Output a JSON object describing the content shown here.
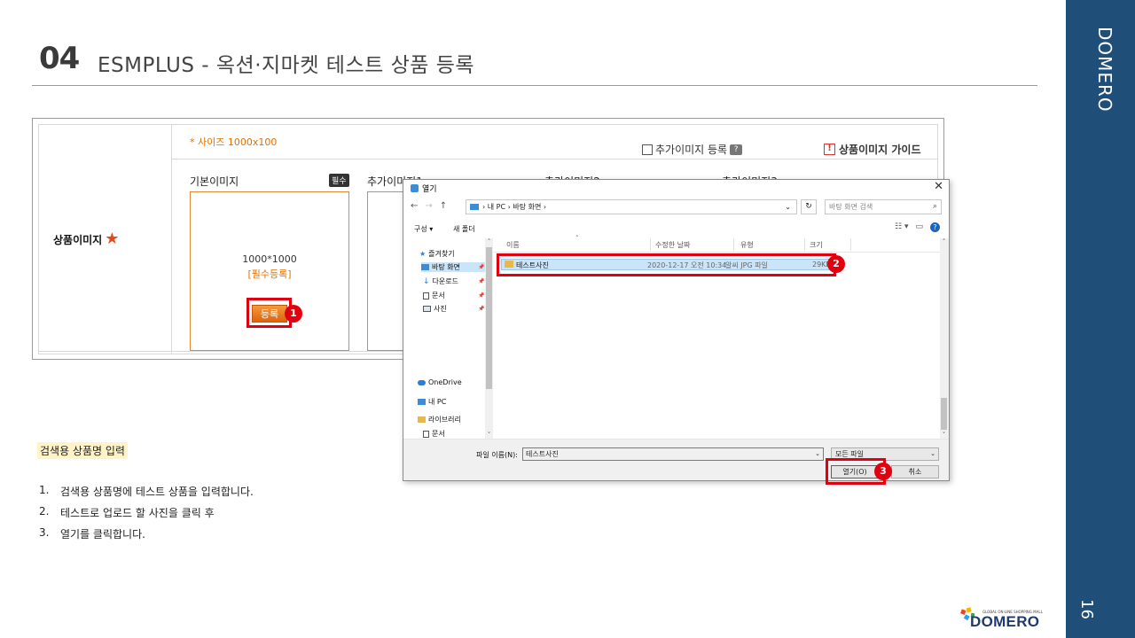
{
  "slide": {
    "number": "04",
    "title": "ESMPLUS - 옥션·지마켓 테스트 상품 등록",
    "brand": "DOMERO",
    "page": "16"
  },
  "esm_form": {
    "row_label": "상품이미지",
    "size_note": "* 사이즈 1000x100",
    "add_image_checkbox": "추가이미지 등록",
    "help_icon_text": "?",
    "guide_link": "상품이미지 가이드",
    "warn_icon_text": "!",
    "base_image_label": "기본이미지",
    "required_badge": "필수",
    "add_image_1": "추가이미지1",
    "add_image_2": "추가이미지2",
    "add_image_3": "추가이미지3",
    "dimensions": "1000*1000",
    "required_register": "[필수등록]",
    "register_button": "등록",
    "star_icon": "★"
  },
  "steps": {
    "s1": "1",
    "s2": "2",
    "s3": "3"
  },
  "description": {
    "section_tag": "검색용 상품명 입력",
    "items": [
      {
        "num": "1.",
        "text": "검색용 상품명에 테스트 상품을 입력합니다."
      },
      {
        "num": "2.",
        "text": "테스트로 업로드 할 사진을 클릭 후"
      },
      {
        "num": "3.",
        "text": "열기를 클릭합니다."
      }
    ]
  },
  "logo": {
    "tagline": "GLOBAL ON-LINE SHOPPING MALL",
    "word": "DOMERO"
  },
  "dialog": {
    "title": "열기",
    "close_glyph": "✕",
    "back_glyph": "←",
    "forward_glyph": "→",
    "up_glyph": "↑",
    "breadcrumb": "›  내 PC  ›  바탕 화면  ›",
    "dropdown_glyph": "⌄",
    "refresh_glyph": "↻",
    "search_placeholder": "바탕 화면 검색",
    "search_glyph": "⌕",
    "organize": "구성 ▾",
    "new_folder": "새 폴더",
    "view_glyph": "☷ ▾",
    "pane_glyph": "▭",
    "help_glyph": "?",
    "scroll_up": "˄",
    "scroll_down": "˅",
    "tree": {
      "favorites": "즐겨찾기",
      "desktop": "바탕 화면",
      "downloads": "다운로드",
      "documents": "문서",
      "pictures": "사진",
      "onedrive": "OneDrive",
      "this_pc": "내 PC",
      "libraries": "라이브러리",
      "lib_documents": "문서",
      "pin_glyph": "📌"
    },
    "columns": {
      "name": "이름",
      "modified": "수정한 날짜",
      "type": "유형",
      "size": "크기",
      "sort_glyph": "˄"
    },
    "file": {
      "name": "테스트사진",
      "modified": "2020-12-17 오전 10:34",
      "type": "알씨 JPG 파일",
      "size": "29KB"
    },
    "filename_label": "파일 이름(N):",
    "filename_value": "테스트사진",
    "filetype": "모든 파일",
    "open_button": "열기(O)",
    "cancel_button": "취소"
  },
  "colors": {
    "sidebar": "#1f4e79",
    "highlight": "#e00010",
    "accent_orange": "#e07000"
  }
}
